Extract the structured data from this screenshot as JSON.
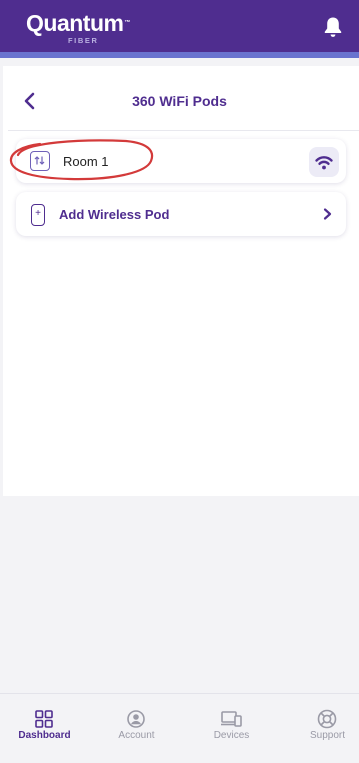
{
  "header": {
    "brand_name": "Quantum",
    "brand_tm": "™",
    "brand_sub": "FIBER",
    "notification_icon": "bell-icon"
  },
  "page": {
    "title": "360 WiFi Pods",
    "back_icon": "chevron-left-icon"
  },
  "pods": [
    {
      "name": "Room 1",
      "icon": "pod-icon",
      "status_icon": "wifi-icon"
    }
  ],
  "add_pod": {
    "label": "Add Wireless Pod",
    "icon": "plus-pod-icon",
    "chevron_icon": "chevron-right-icon"
  },
  "bottom_nav": [
    {
      "label": "Dashboard",
      "icon": "grid-icon",
      "active": true
    },
    {
      "label": "Account",
      "icon": "user-icon",
      "active": false
    },
    {
      "label": "Devices",
      "icon": "devices-icon",
      "active": false
    },
    {
      "label": "Support",
      "icon": "lifebuoy-icon",
      "active": false
    }
  ],
  "colors": {
    "brand_purple": "#4f2d8f",
    "accent_bar": "#6a73cf",
    "annotation_red": "#d33a3a",
    "inactive_gray": "#9a9aa6"
  }
}
